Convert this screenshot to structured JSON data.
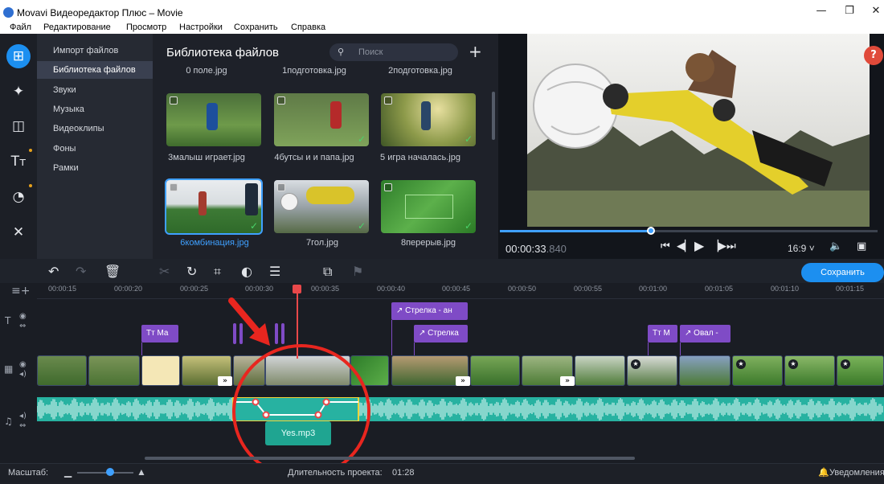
{
  "window": {
    "title": "Movavi Видеоредактор Плюс – Movie"
  },
  "menu": [
    "Файл",
    "Редактирование",
    "Просмотр",
    "Настройки",
    "Сохранить",
    "Справка"
  ],
  "rail_icons": [
    "import-icon",
    "magic-wand-icon",
    "transitions-icon",
    "titles-icon",
    "filters-icon",
    "tools-icon"
  ],
  "categories": [
    "Импорт файлов",
    "Библиотека файлов",
    "Звуки",
    "Музыка",
    "Видеоклипы",
    "Фоны",
    "Рамки"
  ],
  "library": {
    "title": "Библиотека файлов",
    "search_placeholder": "Поиск",
    "top_files": [
      "0 поле.jpg",
      "1подготовка.jpg",
      "2подготовка.jpg"
    ],
    "files": [
      "3малыш играет.jpg",
      "4бутсы и и папа.jpg",
      "5 игра началась.jpg",
      "6комбинация.jpg",
      "7гол.jpg",
      "8перерыв.jpg"
    ]
  },
  "player": {
    "time": "00:00:33",
    "time_ms": ".840",
    "aspect": "16:9 ˅",
    "progress": 0.4,
    "help": "?"
  },
  "toolbar": {
    "save_label": "Сохранить"
  },
  "timeline": {
    "ticks": [
      "00:00:15",
      "00:00:20",
      "00:00:25",
      "00:00:30",
      "00:00:35",
      "00:00:40",
      "00:00:45",
      "00:00:50",
      "00:00:55",
      "00:01:00",
      "00:01:05",
      "00:01:10",
      "00:01:15"
    ],
    "title_clips": [
      "Ма",
      "Стрелка - ан",
      "Стрелка",
      "М",
      "Овал -"
    ],
    "audio_clip": "Yes.mp3"
  },
  "status": {
    "scale_label": "Масштаб:",
    "duration_label": "Длительность проекта:",
    "duration": "01:28",
    "notifications": "Уведомления"
  },
  "colors": {
    "accent": "#1c8ff0",
    "title_clip": "#7f4bc6",
    "audio": "#27b2a1",
    "annotation": "#e8261f"
  }
}
